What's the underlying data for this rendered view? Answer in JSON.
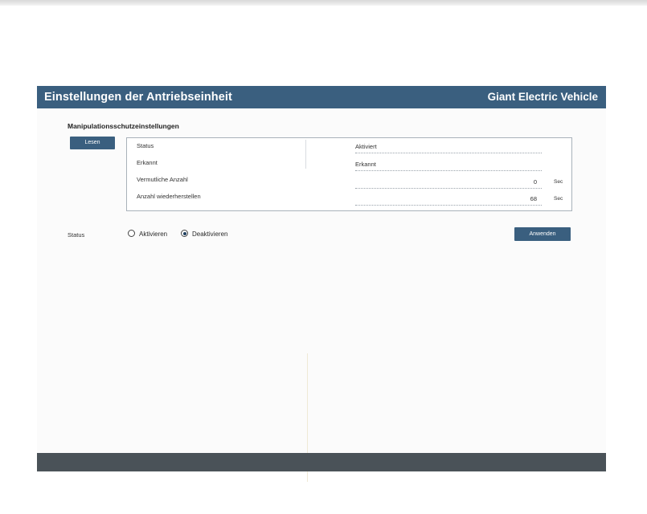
{
  "header": {
    "title": "Einstellungen der Antriebseinheit",
    "brand": "Giant Electric Vehicle"
  },
  "section": {
    "title": "Manipulationsschutzeinstellungen",
    "read_button": "Lesen"
  },
  "info_rows": [
    {
      "label": "Status",
      "value": "Aktiviert",
      "unit": ""
    },
    {
      "label": "Erkannt",
      "value": "Erkannt",
      "unit": ""
    },
    {
      "label": "Vermutliche Anzahl",
      "value": "0",
      "unit": "Sec"
    },
    {
      "label": "Anzahl wiederherstellen",
      "value": "68",
      "unit": "Sec"
    }
  ],
  "status_control": {
    "label": "Status",
    "options": [
      {
        "label": "Aktivieren",
        "checked": false
      },
      {
        "label": "Deaktivieren",
        "checked": true
      }
    ],
    "apply_button": "Anwenden"
  },
  "colors": {
    "header": "#3a5f7f",
    "button": "#3a5f7f",
    "footer": "#4a5258"
  }
}
